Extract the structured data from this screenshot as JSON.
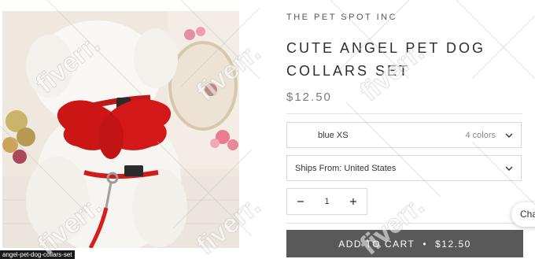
{
  "product": {
    "vendor": "THE PET SPOT INC",
    "title": "CUTE ANGEL PET DOG COLLARS SET",
    "price": "$12.50"
  },
  "image": {
    "filename": "angel-pet-dog-collars-set"
  },
  "variant": {
    "selected": "blue XS",
    "count": "4 colors"
  },
  "shipping": {
    "selected": "Ships From: United States"
  },
  "quantity": {
    "value": "1"
  },
  "cart": {
    "label": "ADD TO CART",
    "separator": "•",
    "price": "$12.50"
  },
  "chat": {
    "label": "Chat"
  },
  "watermark": {
    "text": "fiverr."
  },
  "colors": {
    "button": "#595959",
    "border": "#d9d9d9",
    "wing_red": "#c81414"
  }
}
